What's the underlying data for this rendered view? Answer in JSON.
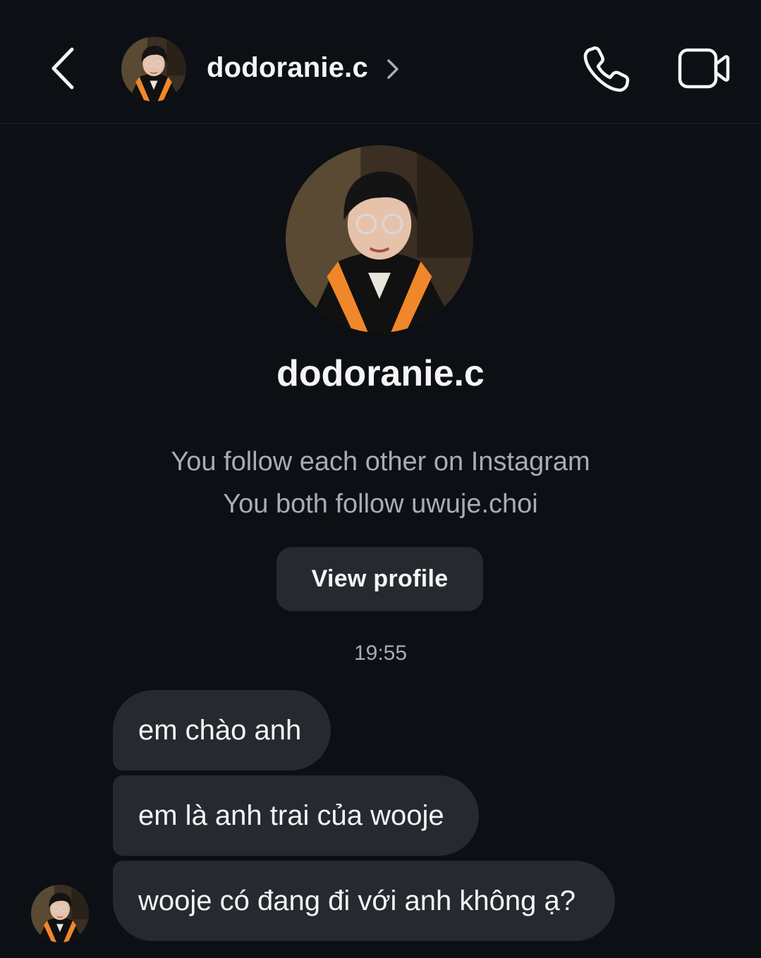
{
  "header": {
    "username": "dodoranie.c",
    "back_icon": "chevron-left-icon",
    "chevron_icon": "chevron-right-icon",
    "call_icon": "phone-icon",
    "video_icon": "video-camera-icon"
  },
  "profile": {
    "name": "dodoranie.c",
    "mutual_line": "You follow each other on Instagram",
    "shared_follow_line": "You both follow uwuje.choi",
    "view_profile_label": "View profile"
  },
  "conversation": {
    "timestamp": "19:55",
    "messages": [
      {
        "text": "em chào anh"
      },
      {
        "text": "em là anh trai của wooje"
      },
      {
        "text": "wooje có đang đi với anh không ạ?"
      }
    ]
  },
  "colors": {
    "background": "#0c1014",
    "bubble": "#262a30",
    "secondary_text": "#a8adb3",
    "accent_orange": "#f0872a"
  }
}
